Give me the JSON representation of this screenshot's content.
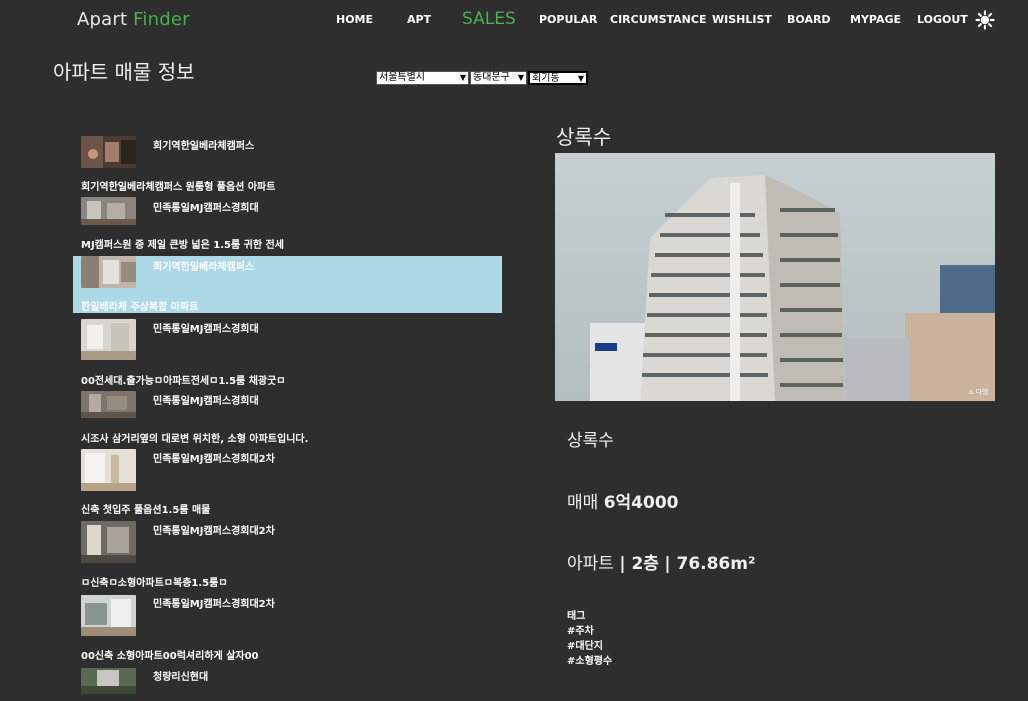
{
  "header": {
    "brand_part1": "Apart",
    "brand_part2": "Finder",
    "nav": {
      "home": "HOME",
      "apt": "APT",
      "sales": "SALES",
      "popular": "POPULAR",
      "circumstance": "CIRCUMSTANCE",
      "wishlist": "WISHLIST",
      "board": "BOARD",
      "mypage": "MYPAGE",
      "logout": "LOGOUT"
    },
    "theme_icon": "sun-icon",
    "active_color": "#4caf50"
  },
  "page_title": "아파트 매물 정보",
  "filters": {
    "city": "서울특별시",
    "district": "동대문구",
    "dong": "회기동"
  },
  "listings": [
    {
      "name": "회기역한일베라체캠퍼스",
      "desc": "회기역한일베라체캠퍼스 원룸형 풀옵션 아파트"
    },
    {
      "name": "민족통일MJ캠퍼스경희대",
      "desc": "MJ캠퍼스원 중 제일 큰방 넓은 1.5룸 귀한 전세"
    },
    {
      "name": "회기역한일베라체캠퍼스",
      "desc": "한일베라체 주상복합 아파트"
    },
    {
      "name": "민족통일MJ캠퍼스경희대",
      "desc": "00전세대.출가능ㅁ아파트전세ㅁ1.5룸 채광굿ㅁ"
    },
    {
      "name": "민족통일MJ캠퍼스경희대",
      "desc": "시조사 삼거리옆의 대로변 위치한, 소형 아파트입니다."
    },
    {
      "name": "민족통일MJ캠퍼스경희대2차",
      "desc": "신축 첫입주 풀옵션1.5룸 매물"
    },
    {
      "name": "민족통일MJ캠퍼스경희대2차",
      "desc": "ㅁ신축ㅁ소형아파트ㅁ복층1.5룸ㅁ"
    },
    {
      "name": "민족통일MJ캠퍼스경희대2차",
      "desc": "00신축 소형아파트00럭셔리하게 살자00"
    },
    {
      "name": "청량리신현대",
      "desc": ""
    }
  ],
  "highlight_color": "#add8e6",
  "detail": {
    "title": "상록수",
    "name": "상록수",
    "price_label": "매매",
    "price_value": "6억4000",
    "type": "아파트",
    "floor": "2층",
    "area": "76.86m²",
    "tags_label": "태그",
    "tags": [
      "#주차",
      "#대단지",
      "#소형평수"
    ]
  }
}
